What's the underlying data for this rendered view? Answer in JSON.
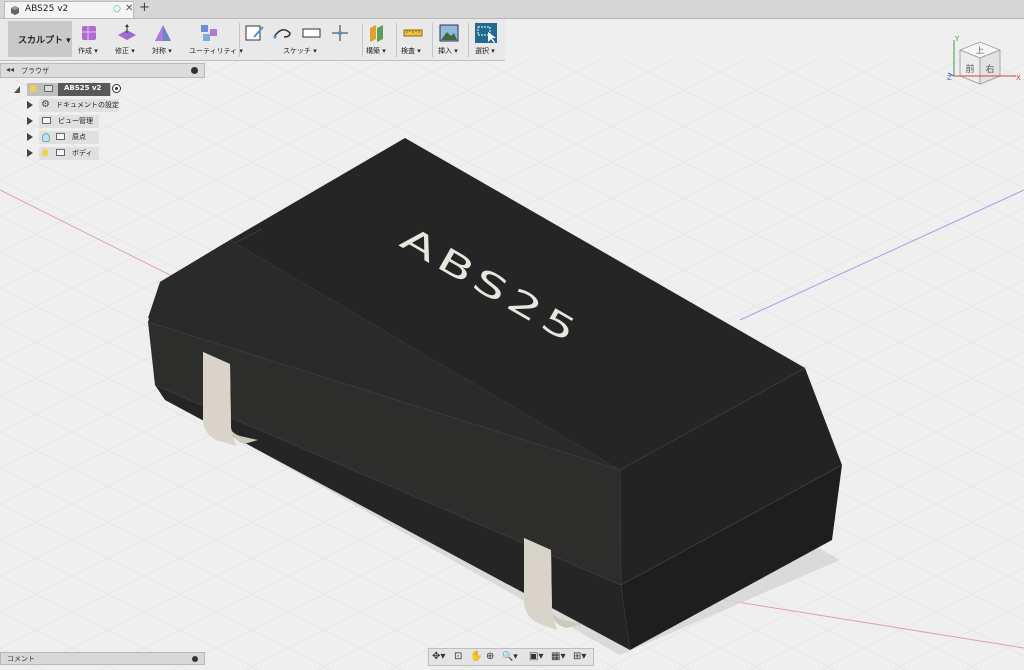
{
  "tab": {
    "title": "ABS25 v2",
    "new_tab": "+",
    "close": "✕",
    "status": "○"
  },
  "toolbar": {
    "workspace": "スカルプト ▾",
    "groups": [
      {
        "name": "create",
        "label": "作成 ▾"
      },
      {
        "name": "modify",
        "label": "修正 ▾"
      },
      {
        "name": "symmetry",
        "label": "対称 ▾"
      },
      {
        "name": "utility",
        "label": "ユーティリティ ▾"
      },
      {
        "name": "sketch",
        "label": "スケッチ ▾"
      },
      {
        "name": "construct",
        "label": "構築 ▾"
      },
      {
        "name": "inspect",
        "label": "検査 ▾"
      },
      {
        "name": "insert",
        "label": "挿入 ▾"
      },
      {
        "name": "select",
        "label": "選択 ▾"
      }
    ]
  },
  "browser": {
    "header": "ブラウザ",
    "collapse": "◂◂",
    "root": "ABS25 v2",
    "items": [
      {
        "label": "ドキュメントの設定"
      },
      {
        "label": "ビュー管理"
      },
      {
        "label": "原点"
      },
      {
        "label": "ボディ"
      }
    ]
  },
  "viewcube": {
    "top": "上",
    "front": "前",
    "right": "右",
    "axis_x": "X",
    "axis_y": "Y",
    "axis_z": "Z"
  },
  "model": {
    "marking": "ABS25"
  },
  "comments": {
    "label": "コメント"
  },
  "navbar": {
    "orbit": "✥▾",
    "lookat": "⊡",
    "pan": "✋",
    "zoom": "⊕",
    "fit": "🔍▾",
    "display": "▣▾",
    "visual": "▦▾",
    "grid": "⊞▾"
  },
  "colors": {
    "body": "#2b2b2a",
    "accent_select": "#1f6a8d",
    "grid": "#d9d9d9"
  }
}
